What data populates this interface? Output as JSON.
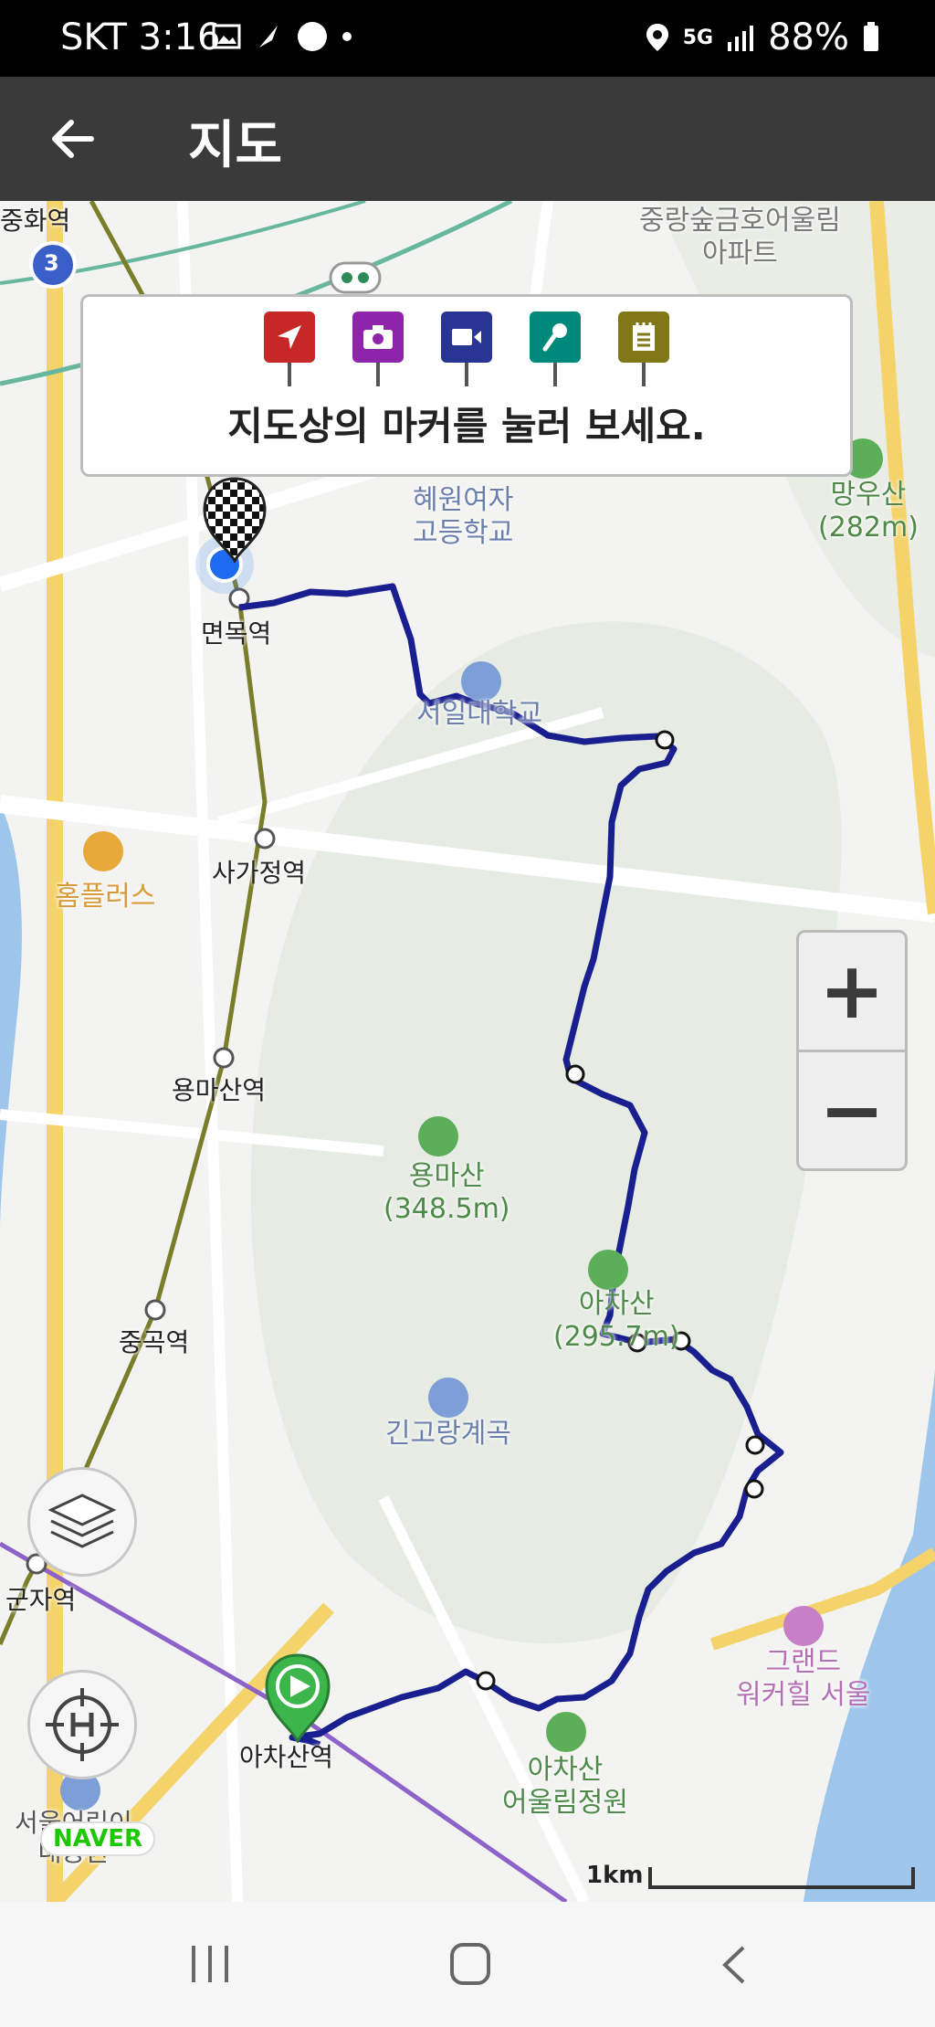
{
  "status_bar": {
    "carrier_time": "SKT 3:16",
    "battery": "88%",
    "network": "5G"
  },
  "app_bar": {
    "title": "지도",
    "back_icon": "arrow-left-icon"
  },
  "marker_legend": {
    "hint": "지도상의 마커를 눌러 보세요.",
    "markers": [
      {
        "name": "location-marker",
        "color": "#c62828"
      },
      {
        "name": "photo-marker",
        "color": "#8e24aa"
      },
      {
        "name": "video-marker",
        "color": "#283593"
      },
      {
        "name": "voice-marker",
        "color": "#00897b"
      },
      {
        "name": "note-marker",
        "color": "#827717"
      }
    ]
  },
  "map_labels": {
    "junghwa": "중화역",
    "apartment_1": "중랑숲금호어울림",
    "apartment_2": "아파트",
    "hyewon_1": "혜원여자",
    "hyewon_2": "고등학교",
    "mangu_1": "망우산",
    "mangu_2": "(282m)",
    "myeonmok": "면목역",
    "seoil": "서일대학교",
    "homeplus": "홈플러스",
    "sagajeong": "사가정역",
    "yongmasan_station": "용마산역",
    "yongmasan_1": "용마산",
    "yongmasan_2": "(348.5m)",
    "achasan_1": "아차산",
    "achasan_2": "(295.7m)",
    "junggok": "중곡역",
    "gingorang": "긴고랑계곡",
    "gunja": "군자역",
    "grand_1": "그랜드",
    "grand_2": "워커힐 서울",
    "achasan_station": "아차산역",
    "park_1": "아차산",
    "park_2": "어울림정원",
    "bottom_left_1": "서울어린이",
    "bottom_left_2": "대공원",
    "line_badge": "3"
  },
  "controls": {
    "zoom_in": "+",
    "zoom_out": "−",
    "layers_icon": "layers-icon",
    "home_icon": "home-location-icon",
    "naver": "NAVER",
    "scale": "1km"
  },
  "colors": {
    "route": "#1a1f8f",
    "subway_line": "#7a7d2a",
    "start_marker": "#3cb54a"
  }
}
